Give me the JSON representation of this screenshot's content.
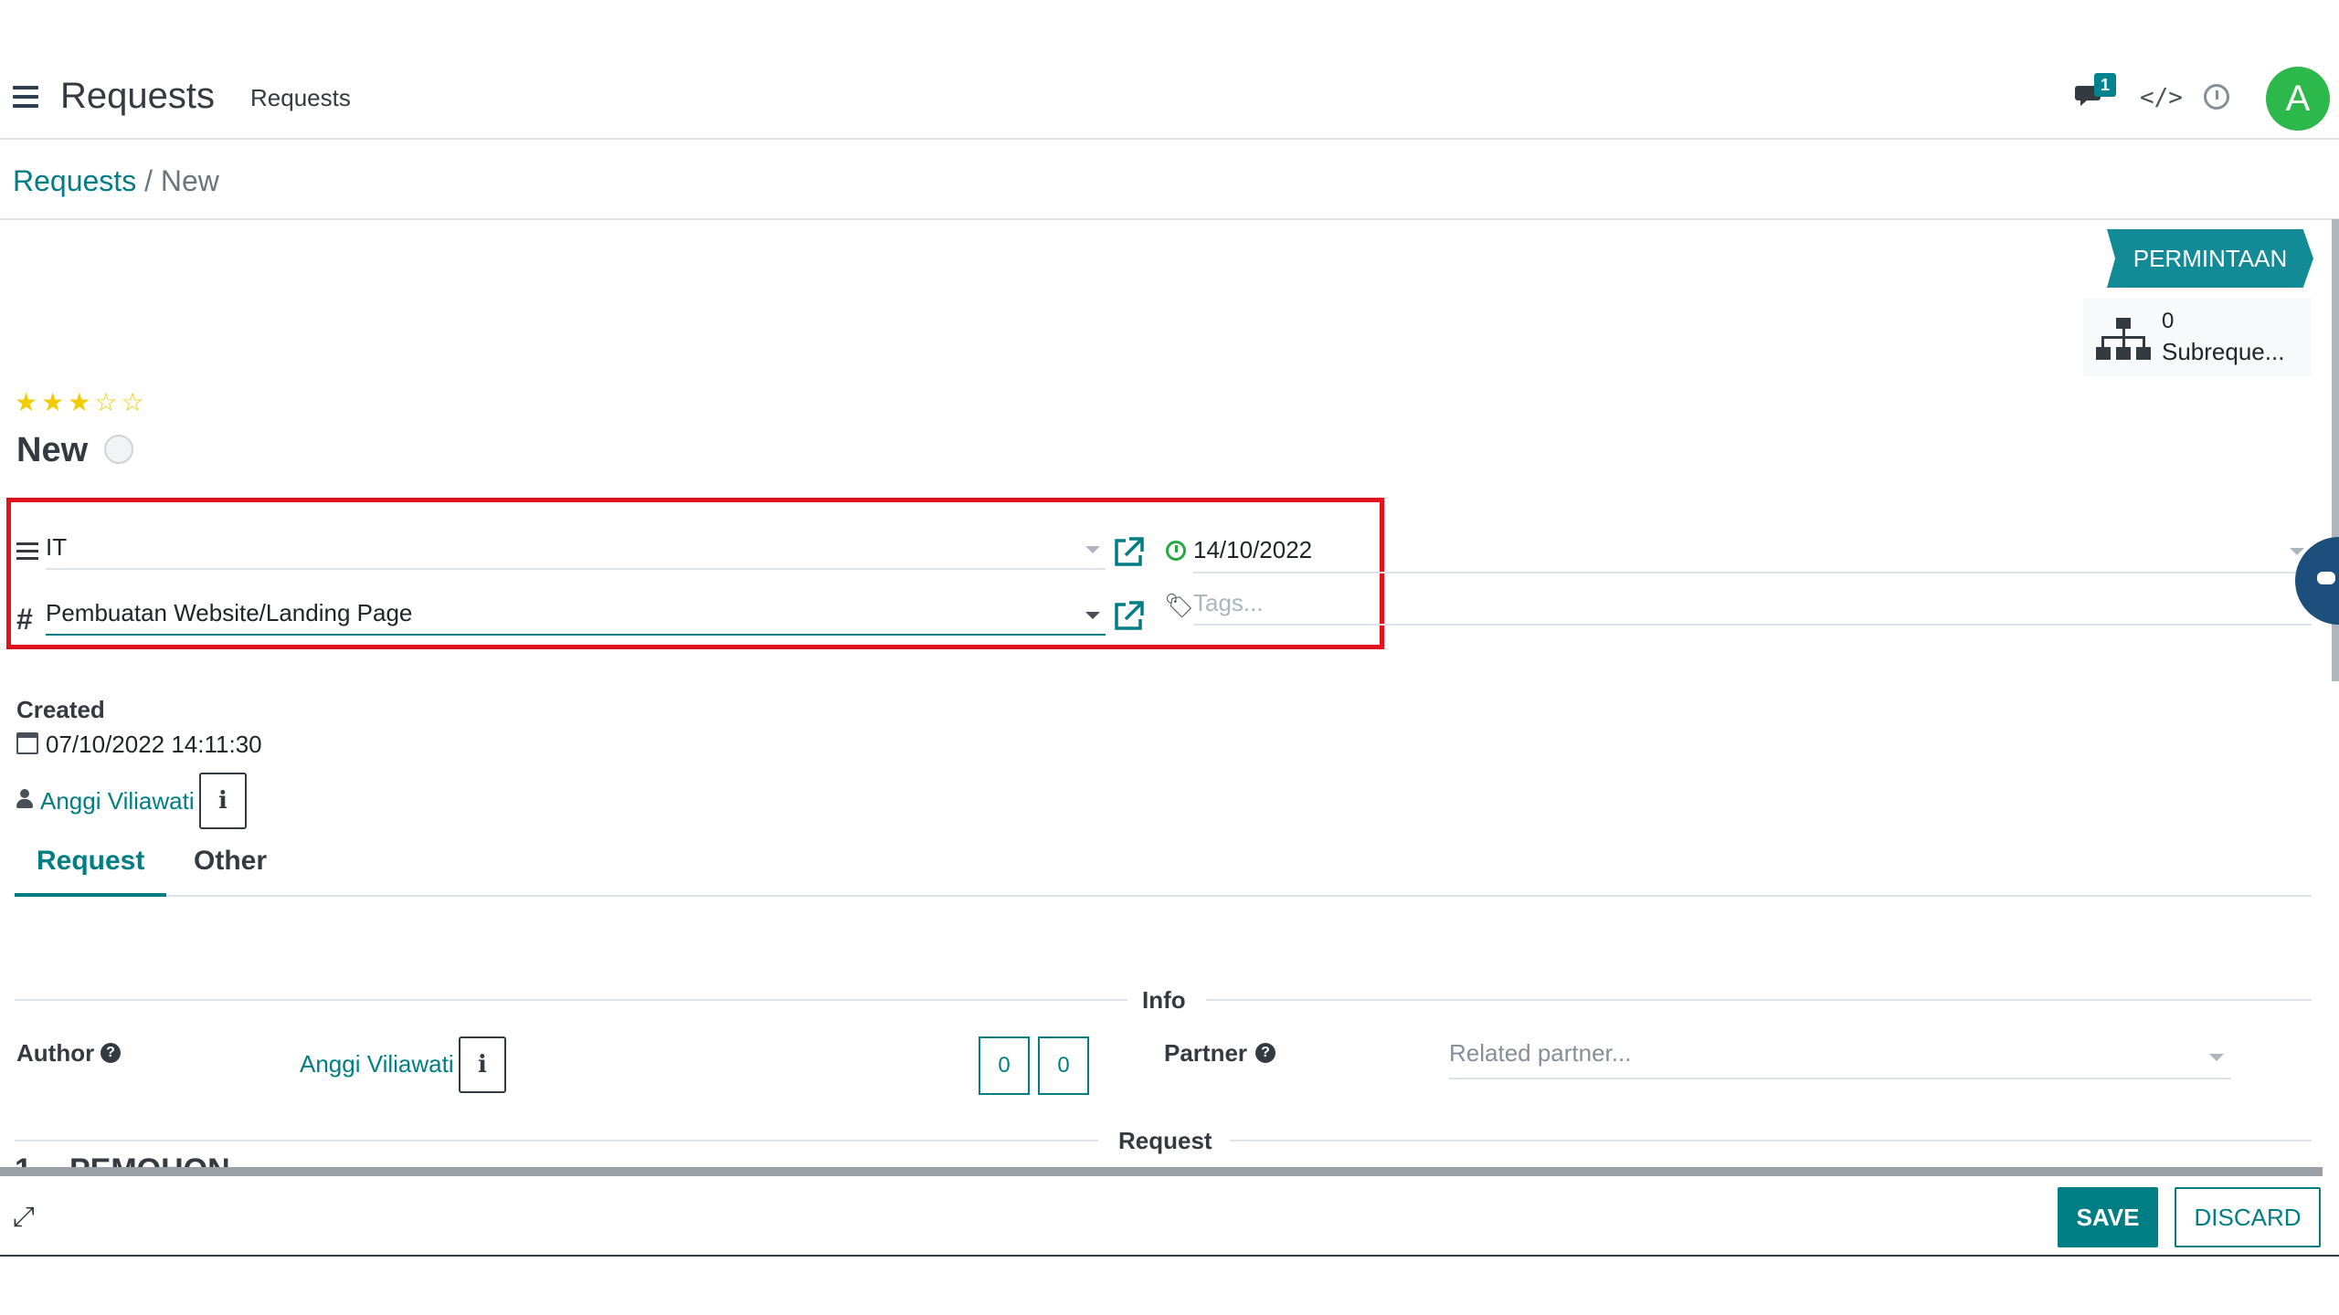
{
  "navbar": {
    "app_title": "Requests",
    "menu_link": "Requests",
    "chat_badge": "1",
    "code_icon": "</>",
    "avatar_letter": "A",
    "avatar_color": "#2db84b"
  },
  "breadcrumb": {
    "parent": "Requests",
    "separator": "/",
    "current": "New"
  },
  "status": {
    "stage": "PERMINTAAN"
  },
  "smart_button": {
    "count": "0",
    "label": "Subreque..."
  },
  "record": {
    "priority_stars": 3,
    "priority_max": 5,
    "name": "New"
  },
  "form": {
    "category_value": "IT",
    "type_value": "Pembuatan Website/Landing Page",
    "date_value": "14/10/2022",
    "tags_placeholder": "Tags..."
  },
  "created": {
    "label": "Created",
    "datetime": "07/10/2022 14:11:30",
    "user": "Anggi Viliawati",
    "info_label": "i"
  },
  "tabs": [
    {
      "label": "Request",
      "active": true
    },
    {
      "label": "Other",
      "active": false
    }
  ],
  "info_section": {
    "title": "Info",
    "author_label": "Author",
    "help_glyph": "?",
    "author_value": "Anggi Viliawati",
    "info_label": "i",
    "count_a": "0",
    "count_b": "0",
    "partner_label": "Partner",
    "partner_placeholder": "Related partner..."
  },
  "request_section": {
    "title": "Request",
    "cut_text": "PEMOHON"
  },
  "bottom_bar": {
    "save_label": "SAVE",
    "discard_label": "DISCARD",
    "expand_icon": "⤢"
  },
  "colors": {
    "accent": "#017e84",
    "highlight": "#e3111c",
    "stage": "#138b96"
  }
}
